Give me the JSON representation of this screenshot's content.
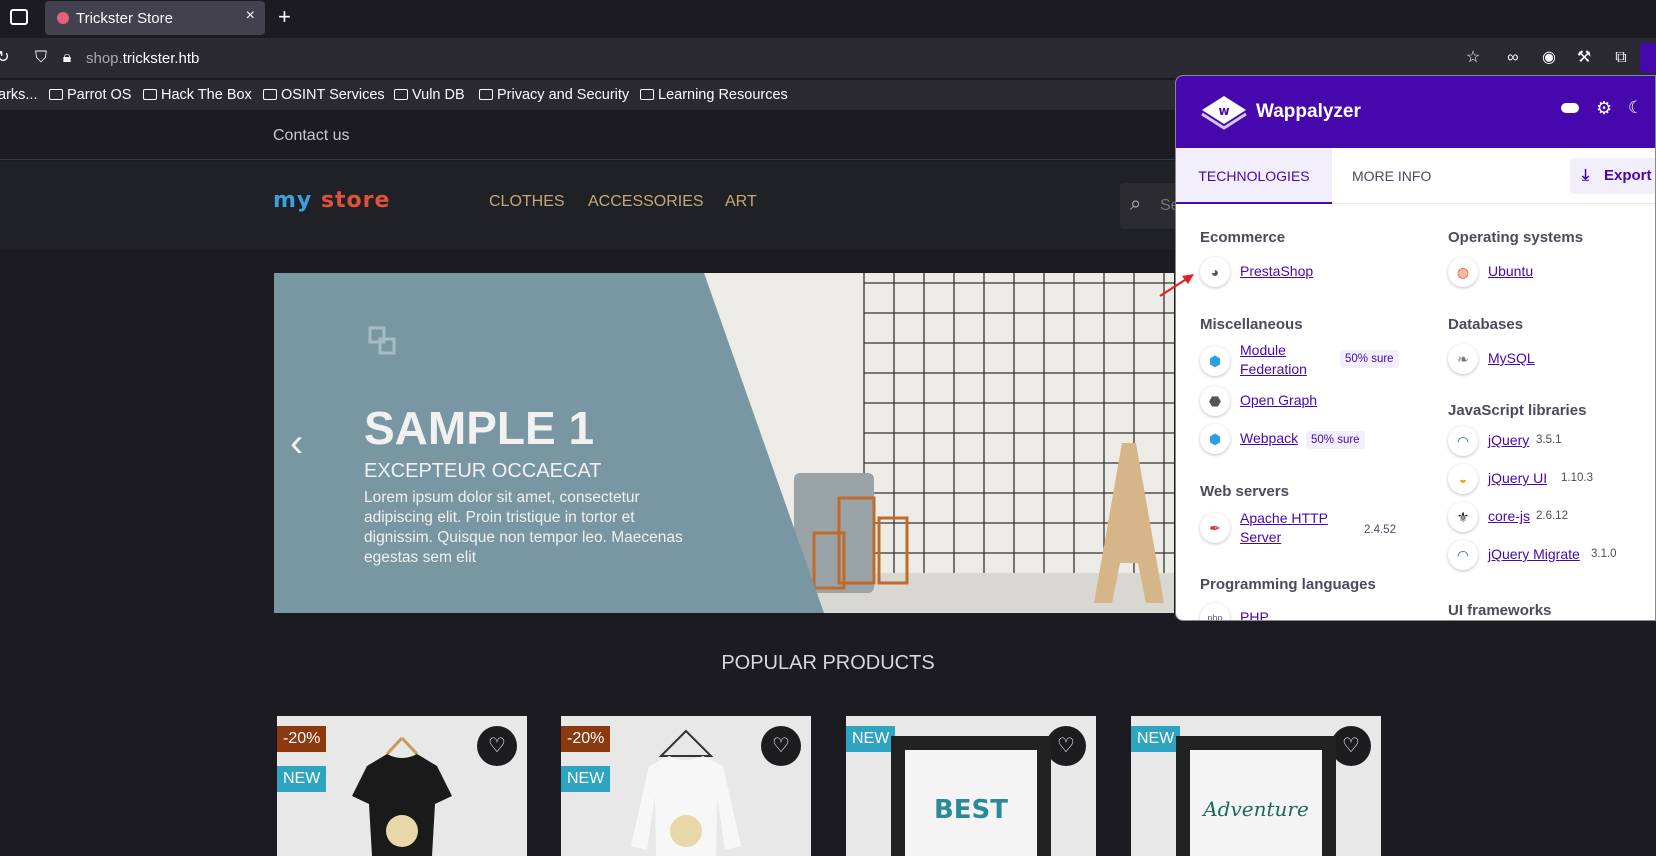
{
  "browser": {
    "tab_title": "Trickster Store",
    "tab_close": "×",
    "new_tab": "+",
    "url_host_prefix": "shop.",
    "url_host_main": "trickster.htb",
    "bookmarks": [
      "arks...",
      "Parrot OS",
      "Hack The Box",
      "OSINT Services",
      "Vuln DB",
      "Privacy and Security",
      "Learning Resources"
    ]
  },
  "site": {
    "contact": "Contact us",
    "logo": "my store",
    "nav": [
      "CLOTHES",
      "ACCESSORIES",
      "ART"
    ],
    "search_placeholder": "Se",
    "hero": {
      "title": "SAMPLE 1",
      "subtitle": "EXCEPTEUR OCCAECAT",
      "body": "Lorem ipsum dolor sit amet, consectetur adipiscing elit. Proin tristique in tortor et dignissim. Quisque non tempor leo. Maecenas egestas sem elit",
      "prev": "‹"
    },
    "popular_title": "POPULAR PRODUCTS",
    "products": [
      {
        "discount": "-20%",
        "badge": "NEW"
      },
      {
        "discount": "-20%",
        "badge": "NEW"
      },
      {
        "badge": "NEW"
      },
      {
        "badge": "NEW"
      }
    ]
  },
  "wappalyzer": {
    "brand": "Wappalyzer",
    "tabs": [
      "TECHNOLOGIES",
      "MORE INFO"
    ],
    "export": "Export",
    "left_col": [
      {
        "category": "Ecommerce",
        "items": [
          {
            "name": "PrestaShop"
          }
        ]
      },
      {
        "category": "Miscellaneous",
        "items": [
          {
            "name": "Module Federation",
            "sure": "50% sure"
          },
          {
            "name": "Open Graph"
          },
          {
            "name": "Webpack",
            "sure": "50% sure"
          }
        ]
      },
      {
        "category": "Web servers",
        "items": [
          {
            "name": "Apache HTTP Server",
            "version": "2.4.52"
          }
        ]
      },
      {
        "category": "Programming languages",
        "items": [
          {
            "name": "PHP"
          }
        ]
      }
    ],
    "right_col": [
      {
        "category": "Operating systems",
        "items": [
          {
            "name": "Ubuntu"
          }
        ]
      },
      {
        "category": "Databases",
        "items": [
          {
            "name": "MySQL"
          }
        ]
      },
      {
        "category": "JavaScript libraries",
        "items": [
          {
            "name": "jQuery",
            "version": "3.5.1"
          },
          {
            "name": "jQuery UI",
            "version": "1.10.3"
          },
          {
            "name": "core-js",
            "version": "2.6.12"
          },
          {
            "name": "jQuery Migrate",
            "version": "3.1.0"
          }
        ]
      },
      {
        "category": "UI frameworks",
        "items": []
      }
    ]
  }
}
